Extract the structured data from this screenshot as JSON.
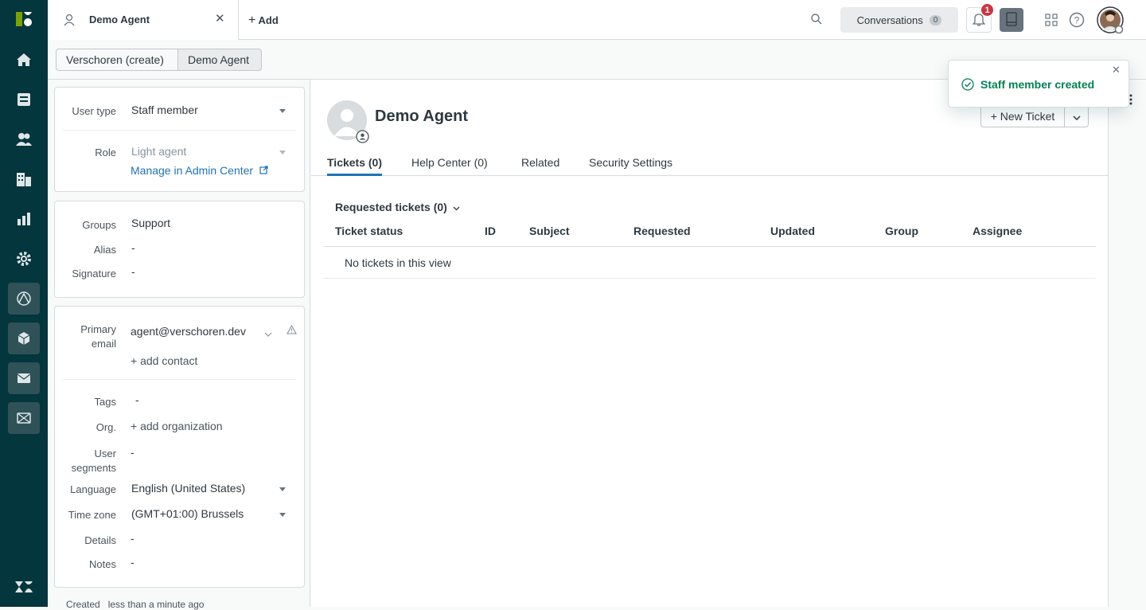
{
  "topbar": {
    "tab_label": "Demo Agent",
    "add_label": "Add",
    "conversations_label": "Conversations",
    "conversations_count": "0",
    "notification_count": "1"
  },
  "breadcrumbs": [
    "Verschoren (create)",
    "Demo Agent"
  ],
  "toast": {
    "message": "Staff member created"
  },
  "user_card": {
    "user_type_label": "User type",
    "user_type_value": "Staff member",
    "role_label": "Role",
    "role_value": "Light agent",
    "manage_link": "Manage in Admin Center"
  },
  "groups_card": {
    "groups_label": "Groups",
    "groups_value": "Support",
    "alias_label": "Alias",
    "alias_value": "-",
    "signature_label": "Signature",
    "signature_value": "-"
  },
  "contact_card": {
    "primary_email_label_1": "Primary",
    "primary_email_label_2": "email",
    "primary_email_value": "agent@verschoren.dev",
    "add_contact": "+ add contact",
    "tags_label": "Tags",
    "tags_value": "-",
    "org_label": "Org.",
    "org_value": "+ add organization",
    "segments_label_1": "User",
    "segments_label_2": "segments",
    "segments_value": "-",
    "language_label": "Language",
    "language_value": "English (United States)",
    "timezone_label": "Time zone",
    "timezone_value": "(GMT+01:00) Brussels",
    "details_label": "Details",
    "details_value": "-",
    "notes_label": "Notes",
    "notes_value": "-"
  },
  "footer": {
    "created_label": "Created",
    "created_value": "less than a minute ago"
  },
  "profile": {
    "name": "Demo Agent",
    "new_ticket": "+ New Ticket"
  },
  "tabs": [
    "Tickets (0)",
    "Help Center (0)",
    "Related",
    "Security Settings"
  ],
  "tickets": {
    "section_title": "Requested tickets (0)",
    "columns": [
      "Ticket status",
      "ID",
      "Subject",
      "Requested",
      "Updated",
      "Group",
      "Assignee"
    ],
    "empty_message": "No tickets in this view"
  },
  "colors": {
    "sidebar": "#03363d",
    "accent": "#1f73b7",
    "success": "#038153",
    "badge": "#cc3340"
  }
}
